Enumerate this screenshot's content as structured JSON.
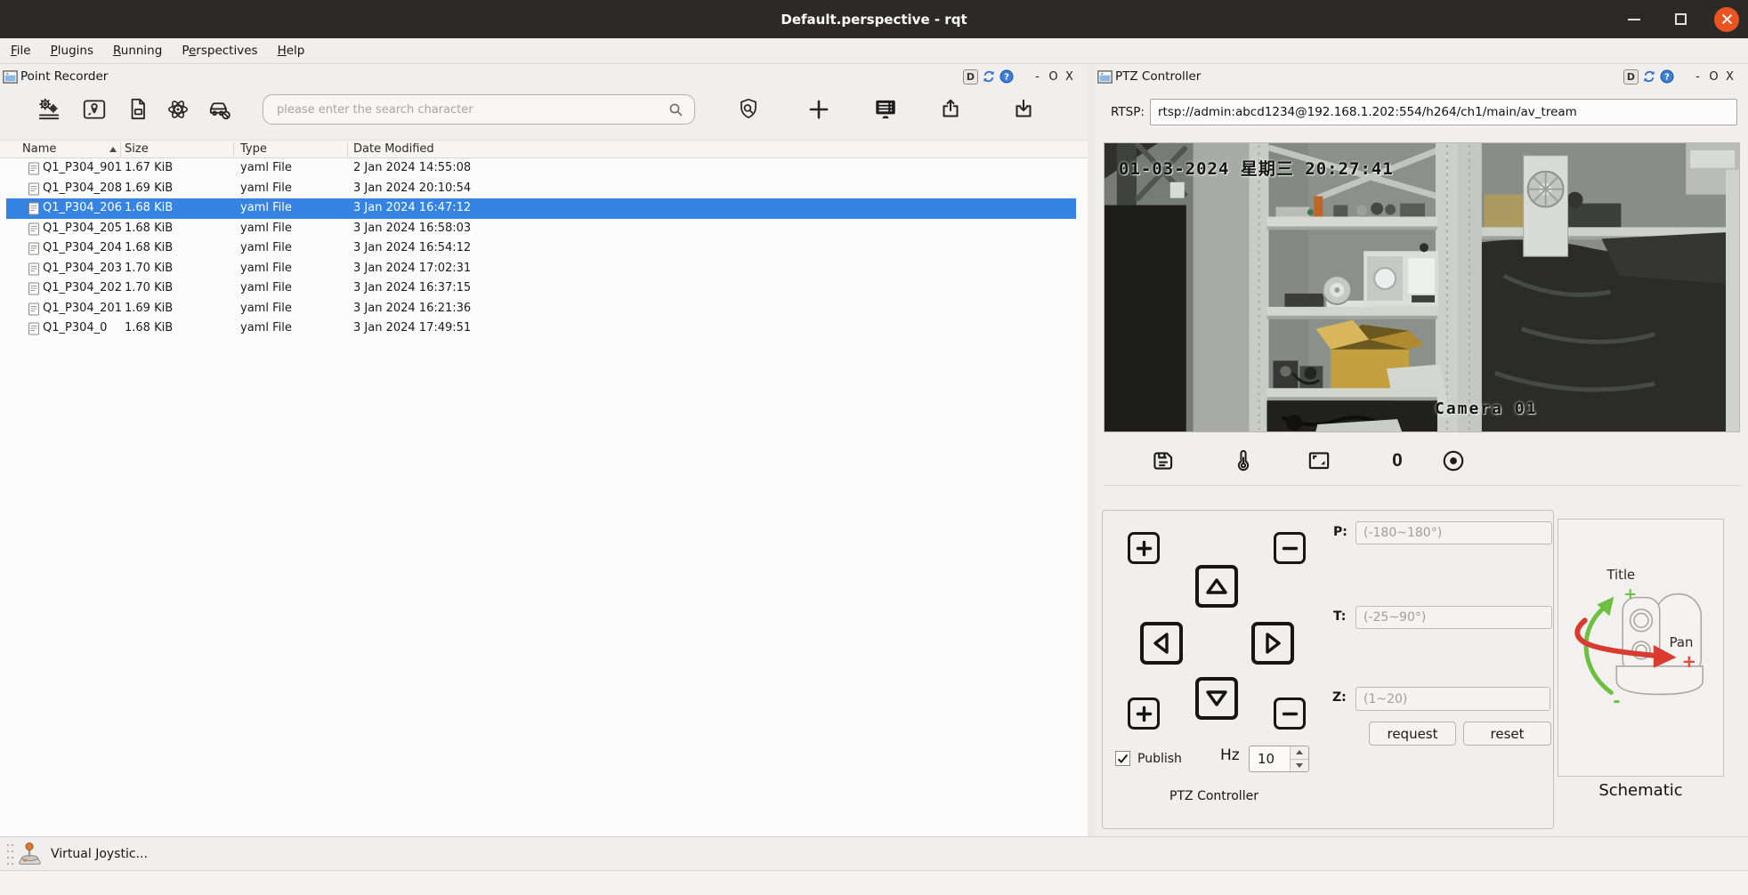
{
  "window": {
    "title": "Default.perspective - rqt"
  },
  "menu": {
    "items": [
      {
        "label": "File",
        "mnemonic": 0
      },
      {
        "label": "Plugins",
        "mnemonic": 0
      },
      {
        "label": "Running",
        "mnemonic": 0
      },
      {
        "label": "Perspectives",
        "mnemonic": 1
      },
      {
        "label": "Help",
        "mnemonic": 0
      }
    ]
  },
  "dock_controls": {
    "detach": "D",
    "help": "?",
    "minimize": "-",
    "restore": "O",
    "close": "X"
  },
  "point_recorder": {
    "title": "Point Recorder",
    "search": {
      "placeholder": "please enter the search character"
    },
    "toolbar_icons": [
      "record-settings",
      "waypoint-map",
      "yaml-file",
      "frames-atom",
      "vehicle-disable",
      "shield-search",
      "add",
      "list-display",
      "export",
      "import"
    ],
    "table": {
      "columns": [
        "Name",
        "Size",
        "Type",
        "Date Modified"
      ],
      "rows": [
        {
          "name": "Q1_P304_901",
          "size": "1.67 KiB",
          "type": "yaml File",
          "modified": "2 Jan 2024 14:55:08",
          "selected": false
        },
        {
          "name": "Q1_P304_208",
          "size": "1.69 KiB",
          "type": "yaml File",
          "modified": "3 Jan 2024 20:10:54",
          "selected": false
        },
        {
          "name": "Q1_P304_206",
          "size": "1.68 KiB",
          "type": "yaml File",
          "modified": "3 Jan 2024 16:47:12",
          "selected": true
        },
        {
          "name": "Q1_P304_205",
          "size": "1.68 KiB",
          "type": "yaml File",
          "modified": "3 Jan 2024 16:58:03",
          "selected": false
        },
        {
          "name": "Q1_P304_204",
          "size": "1.68 KiB",
          "type": "yaml File",
          "modified": "3 Jan 2024 16:54:12",
          "selected": false
        },
        {
          "name": "Q1_P304_203",
          "size": "1.70 KiB",
          "type": "yaml File",
          "modified": "3 Jan 2024 17:02:31",
          "selected": false
        },
        {
          "name": "Q1_P304_202",
          "size": "1.70 KiB",
          "type": "yaml File",
          "modified": "3 Jan 2024 16:37:15",
          "selected": false
        },
        {
          "name": "Q1_P304_201",
          "size": "1.69 KiB",
          "type": "yaml File",
          "modified": "3 Jan 2024 16:21:36",
          "selected": false
        },
        {
          "name": "Q1_P304_0",
          "size": "1.68 KiB",
          "type": "yaml File",
          "modified": "3 Jan 2024 17:49:51",
          "selected": false
        }
      ]
    }
  },
  "ptz": {
    "title": "PTZ Controller",
    "rtsp_label": "RTSP:",
    "rtsp_value": "rtsp://admin:abcd1234@192.168.1.202:554/h264/ch1/main/av_tream",
    "video": {
      "timestamp": "01-03-2024 星期三 20:27:41",
      "camera_label": "Camera 01"
    },
    "video_toolbar": {
      "zoom_count": "0"
    },
    "publish_label": "Publish",
    "hz_label": "Hz",
    "hz_value": "10",
    "pad_label": "PTZ Controller",
    "fields": {
      "p_label": "P:",
      "p_placeholder": "(-180~180°)",
      "t_label": "T:",
      "t_placeholder": "(-25~90°)",
      "z_label": "Z:",
      "z_placeholder": "(1~20)"
    },
    "buttons": {
      "request": "request",
      "reset": "reset"
    },
    "schematic": {
      "caption": "Schematic",
      "tilt_label": "Title",
      "pan_label": "Pan",
      "tilt_plus": "+",
      "tilt_minus": "-",
      "pan_plus": "+"
    }
  },
  "statusbar": {
    "items": [
      {
        "label": "Virtual Joystic..."
      }
    ]
  },
  "colors": {
    "selection": "#3584e4",
    "titlebar": "#2c2a28",
    "close_button": "#e95420",
    "accent_blue": "#3d7fd6",
    "schematic_green": "#6cbf3f",
    "schematic_red": "#d93b30",
    "box_yellow": "#c49f40"
  }
}
